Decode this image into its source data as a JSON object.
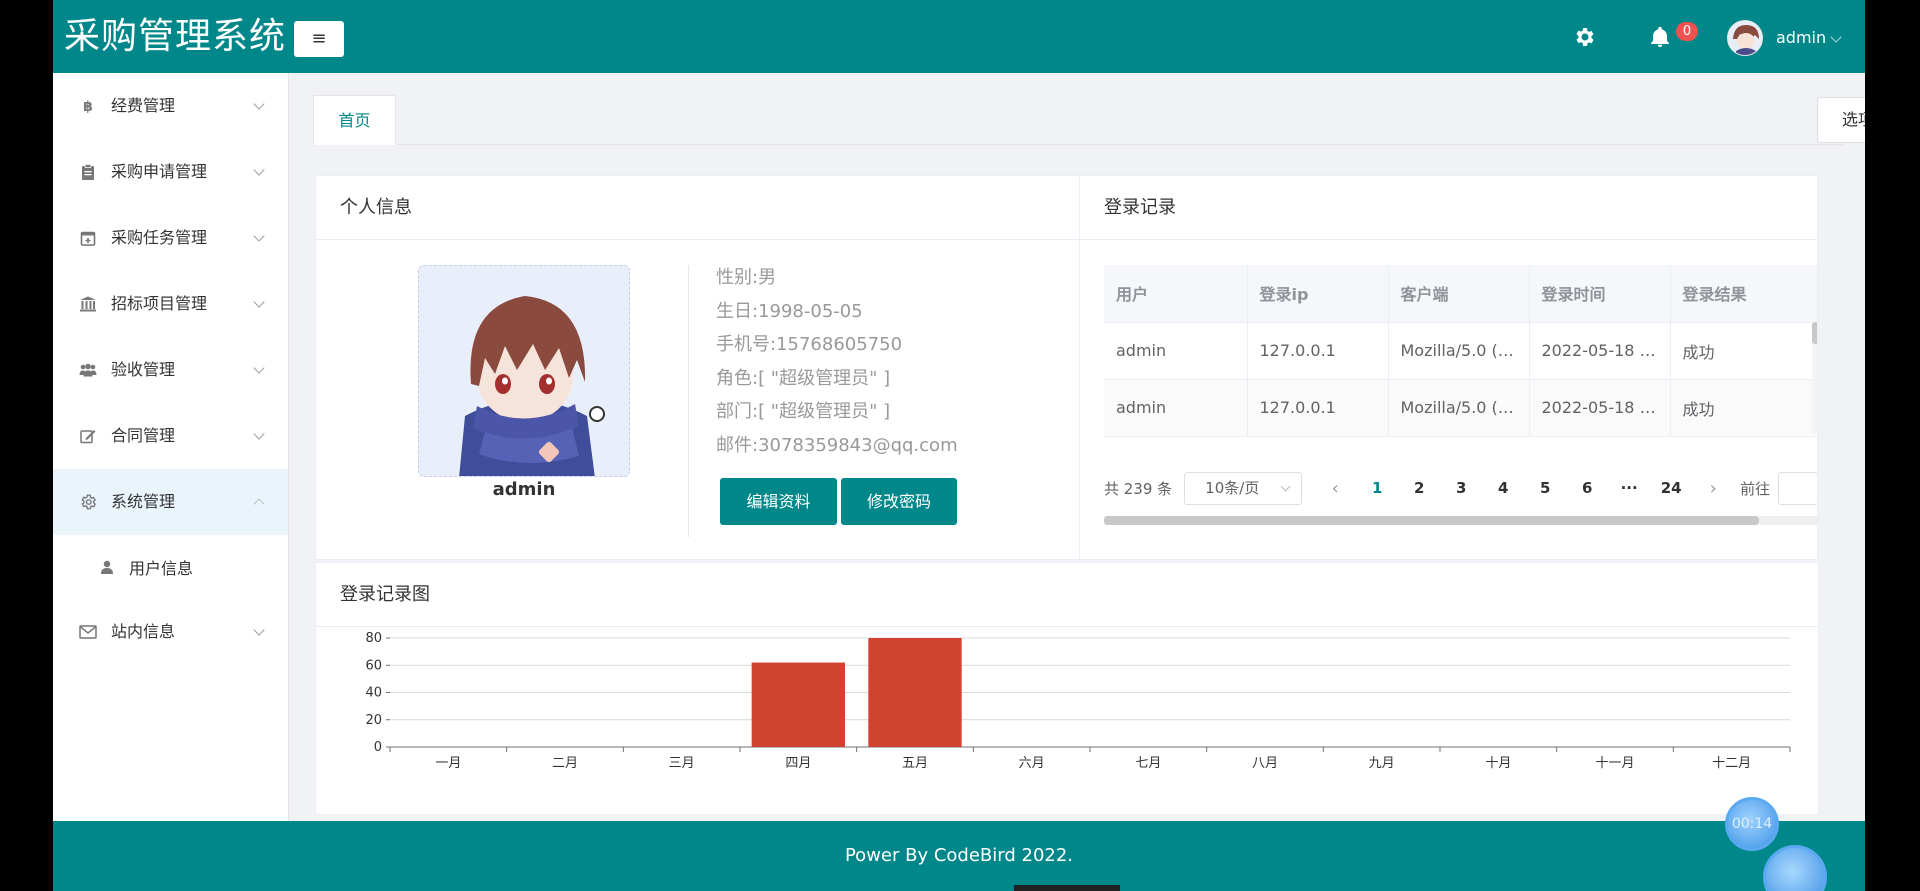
{
  "header": {
    "brand": "采购管理系统",
    "menu_toggle_label": "≡",
    "notification_count": "0",
    "user_name": "admin",
    "accent_color": "#00878a"
  },
  "sidebar": {
    "items": [
      {
        "label": "经费管理",
        "icon": "bitcoin-icon"
      },
      {
        "label": "采购申请管理",
        "icon": "clipboard-icon"
      },
      {
        "label": "采购任务管理",
        "icon": "calendar-plus-icon"
      },
      {
        "label": "招标项目管理",
        "icon": "bank-icon"
      },
      {
        "label": "验收管理",
        "icon": "users-icon"
      },
      {
        "label": "合同管理",
        "icon": "edit-icon"
      },
      {
        "label": "系统管理",
        "icon": "gear-icon",
        "expanded": true
      },
      {
        "label": "站内信息",
        "icon": "envelope-icon"
      }
    ],
    "sub_items": [
      {
        "label": "用户信息",
        "icon": "user-icon"
      }
    ]
  },
  "tabs": {
    "home": "首页",
    "options": "选项"
  },
  "profile": {
    "title": "个人信息",
    "name": "admin",
    "gender": "性别:男",
    "birthday": "生日:1998-05-05",
    "phone": "手机号:15768605750",
    "role": "角色:[ \"超级管理员\" ]",
    "department": "部门:[ \"超级管理员\" ]",
    "email": "邮件:3078359843@qq.com",
    "edit_button": "编辑资料",
    "password_button": "修改密码"
  },
  "login_records": {
    "title": "登录记录",
    "columns": [
      "用户",
      "登录ip",
      "客户端",
      "登录时间",
      "登录结果"
    ],
    "rows": [
      [
        "admin",
        "127.0.0.1",
        "Mozilla/5.0 (…",
        "2022-05-18 …",
        "成功"
      ],
      [
        "admin",
        "127.0.0.1",
        "Mozilla/5.0 (…",
        "2022-05-18 …",
        "成功"
      ]
    ],
    "pagination": {
      "total": "共 239 条",
      "page_size": "10条/页",
      "pages": [
        "1",
        "2",
        "3",
        "4",
        "5",
        "6",
        "···",
        "24"
      ],
      "current": "1",
      "prev": "‹",
      "next": "›",
      "goto": "前往"
    }
  },
  "chart_section": {
    "title": "登录记录图"
  },
  "chart_data": {
    "type": "bar",
    "categories": [
      "一月",
      "二月",
      "三月",
      "四月",
      "五月",
      "六月",
      "七月",
      "八月",
      "九月",
      "十月",
      "十一月",
      "十二月"
    ],
    "values": [
      0,
      0,
      0,
      62,
      80,
      0,
      0,
      0,
      0,
      0,
      0,
      0
    ],
    "ylim": [
      0,
      80
    ],
    "yticks": [
      0,
      20,
      40,
      60,
      80
    ],
    "grid": true,
    "bar_color": "#cf4330"
  },
  "footer": {
    "text": "Power By CodeBird 2022."
  },
  "timer": {
    "value": "00:14"
  }
}
